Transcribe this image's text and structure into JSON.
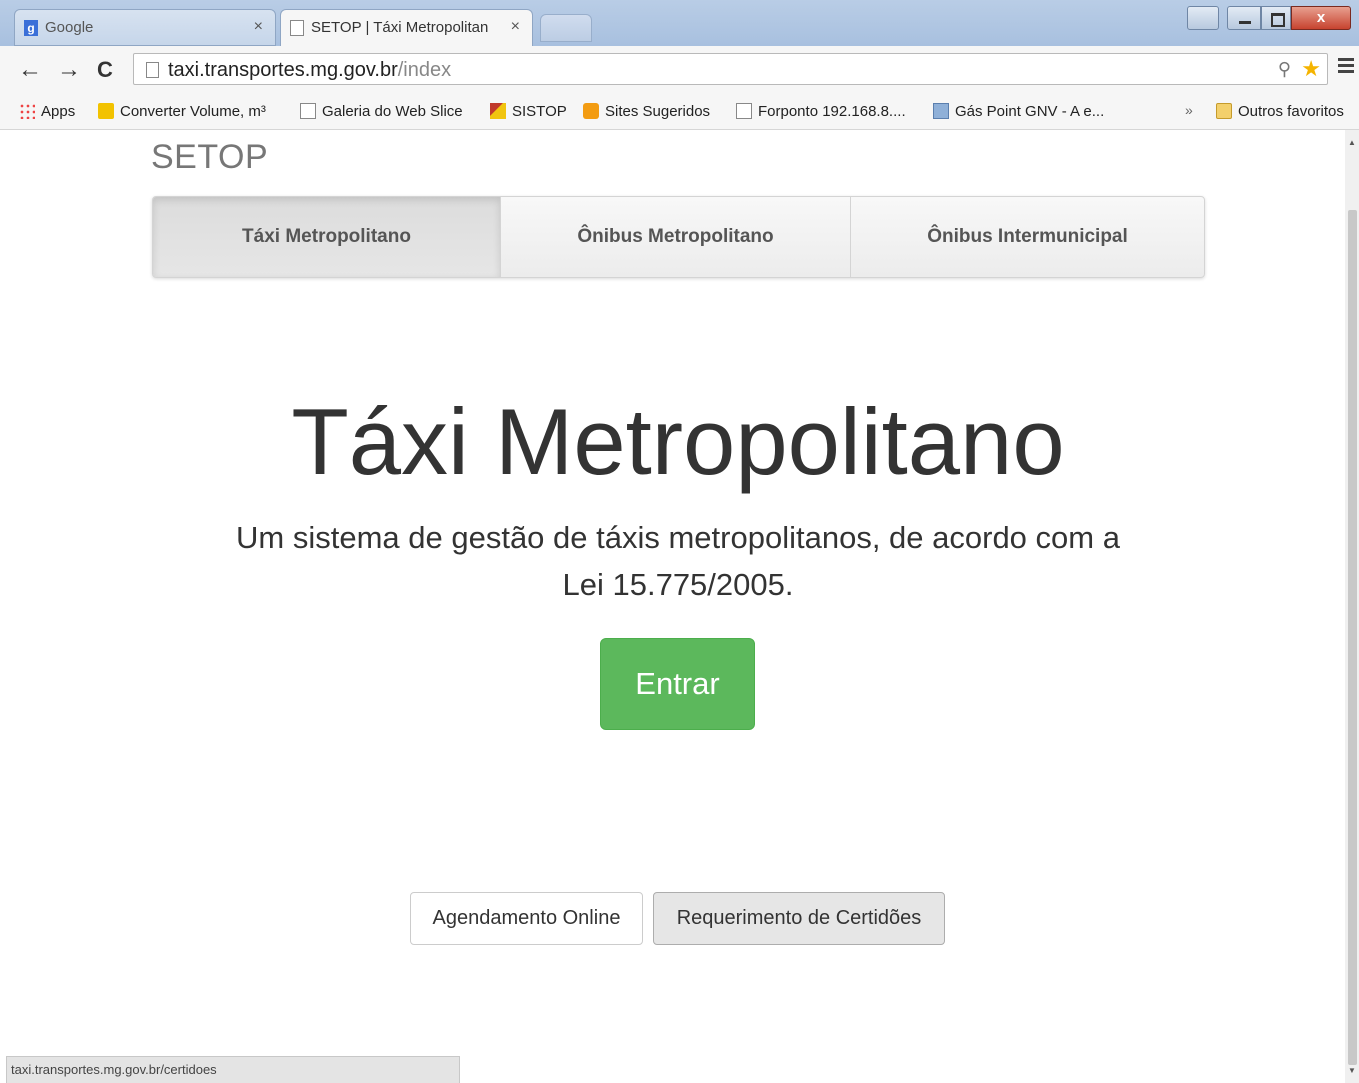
{
  "browser": {
    "tabs": [
      {
        "label": "Google",
        "active": false
      },
      {
        "label": "SETOP | Táxi Metropolitan",
        "active": true
      }
    ],
    "close_glyph": "×",
    "window_controls": {
      "close": "x"
    },
    "url": {
      "host": "taxi.transportes.mg.gov.br",
      "path": "/index"
    },
    "bookmarks": [
      {
        "label": "Apps",
        "icon": "apps-icon"
      },
      {
        "label": "Converter Volume, m³",
        "icon": "converter-icon"
      },
      {
        "label": "Galeria do Web Slice",
        "icon": "page-icon"
      },
      {
        "label": "SISTOP",
        "icon": "sistop-icon"
      },
      {
        "label": "Sites Sugeridos",
        "icon": "sites-icon"
      },
      {
        "label": "Forponto 192.168.8....",
        "icon": "page-icon"
      },
      {
        "label": "Gás Point GNV - A e...",
        "icon": "gas-icon"
      },
      {
        "label": "Outros favoritos",
        "icon": "folder-icon"
      }
    ],
    "bookmarks_overflow": "»",
    "status_url": "taxi.transportes.mg.gov.br/certidoes"
  },
  "page": {
    "brand": "SETOP",
    "nav": [
      {
        "label": "Táxi Metropolitano",
        "active": true
      },
      {
        "label": "Ônibus Metropolitano",
        "active": false
      },
      {
        "label": "Ônibus Intermunicipal",
        "active": false
      }
    ],
    "hero": {
      "title": "Táxi Metropolitano",
      "subtitle": "Um sistema de gestão de táxis metropolitanos, de acordo com a Lei 15.775/2005.",
      "enter_label": "Entrar"
    },
    "actions": {
      "agenda_label": "Agendamento Online",
      "certidoes_label": "Requerimento de Certidões"
    }
  },
  "colors": {
    "success_green": "#5cb85c",
    "brand_gray": "#777777"
  }
}
